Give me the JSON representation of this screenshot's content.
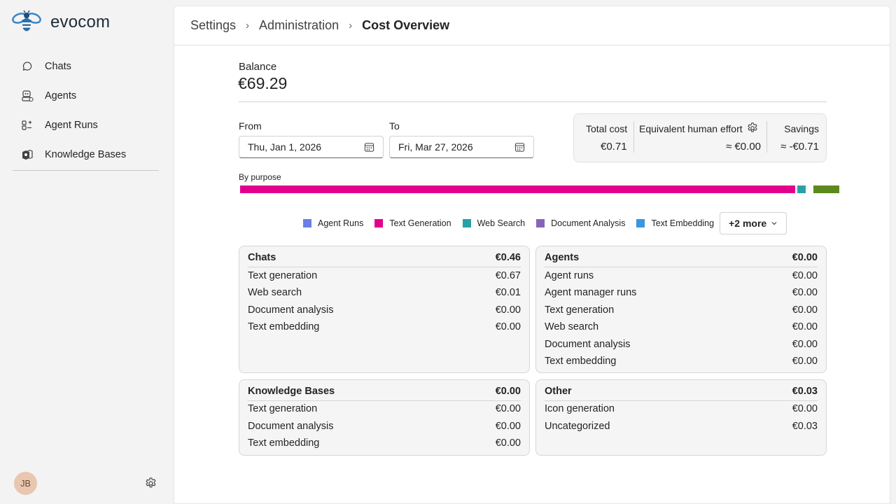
{
  "app": {
    "name": "evocom"
  },
  "sidebar": {
    "items": [
      {
        "label": "Chats",
        "icon": "chat-icon"
      },
      {
        "label": "Agents",
        "icon": "agent-icon"
      },
      {
        "label": "Agent Runs",
        "icon": "agent-runs-icon"
      },
      {
        "label": "Knowledge Bases",
        "icon": "knowledge-base-icon"
      }
    ],
    "user_initials": "JB"
  },
  "breadcrumb": {
    "items": [
      "Settings",
      "Administration"
    ],
    "current": "Cost Overview"
  },
  "balance": {
    "label": "Balance",
    "value": "€69.29"
  },
  "date_range": {
    "from_label": "From",
    "from_value": "Thu, Jan 1, 2026",
    "to_label": "To",
    "to_value": "Fri, Mar 27, 2026"
  },
  "summary": {
    "total_cost_label": "Total cost",
    "total_cost_value": "€0.71",
    "human_effort_label": "Equivalent human effort",
    "human_effort_value": "≈ €0.00",
    "savings_label": "Savings",
    "savings_value": "≈ -€0.71"
  },
  "purpose_chart": {
    "label": "By purpose",
    "segments": [
      {
        "name": "Text Generation",
        "color": "#e3008c",
        "value": 0.67
      },
      {
        "name": "Web Search",
        "color": "#2aa0a4",
        "value": 0.01
      },
      {
        "name": "Uncategorized",
        "color": "#5c8a1e",
        "value": 0.03
      }
    ]
  },
  "legend": {
    "items": [
      {
        "label": "Agent Runs",
        "color": "#6b7fe8"
      },
      {
        "label": "Text Generation",
        "color": "#e3008c"
      },
      {
        "label": "Web Search",
        "color": "#2aa0a4"
      },
      {
        "label": "Document Analysis",
        "color": "#8764b8"
      },
      {
        "label": "Text Embedding",
        "color": "#3a96dd"
      }
    ],
    "more_label": "+2 more"
  },
  "cards": {
    "chats": {
      "title": "Chats",
      "total": "€0.46",
      "rows": [
        {
          "label": "Text generation",
          "value": "€0.67"
        },
        {
          "label": "Web search",
          "value": "€0.01"
        },
        {
          "label": "Document analysis",
          "value": "€0.00"
        },
        {
          "label": "Text embedding",
          "value": "€0.00"
        }
      ]
    },
    "agents": {
      "title": "Agents",
      "total": "€0.00",
      "rows": [
        {
          "label": "Agent runs",
          "value": "€0.00"
        },
        {
          "label": "Agent manager runs",
          "value": "€0.00"
        },
        {
          "label": "Text generation",
          "value": "€0.00"
        },
        {
          "label": "Web search",
          "value": "€0.00"
        },
        {
          "label": "Document analysis",
          "value": "€0.00"
        },
        {
          "label": "Text embedding",
          "value": "€0.00"
        }
      ]
    },
    "knowledge_bases": {
      "title": "Knowledge Bases",
      "total": "€0.00",
      "rows": [
        {
          "label": "Text generation",
          "value": "€0.00"
        },
        {
          "label": "Document analysis",
          "value": "€0.00"
        },
        {
          "label": "Text embedding",
          "value": "€0.00"
        }
      ]
    },
    "other": {
      "title": "Other",
      "total": "€0.03",
      "rows": [
        {
          "label": "Icon generation",
          "value": "€0.00"
        },
        {
          "label": "Uncategorized",
          "value": "€0.03"
        }
      ]
    }
  }
}
